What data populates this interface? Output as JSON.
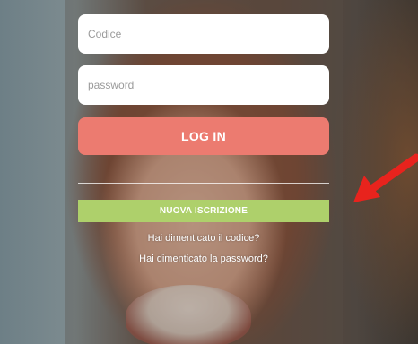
{
  "login_form": {
    "code_placeholder": "Codice",
    "password_placeholder": "password",
    "login_label": "LOG IN",
    "signup_label": "NUOVA ISCRIZIONE",
    "forgot_code": "Hai dimenticato il codice?",
    "forgot_password": "Hai dimenticato la password?"
  },
  "colors": {
    "login_button": "#ec7b70",
    "signup_button": "#aed06b",
    "arrow": "#e8231d"
  },
  "icons": {
    "annotation_arrow": "arrow-icon"
  }
}
